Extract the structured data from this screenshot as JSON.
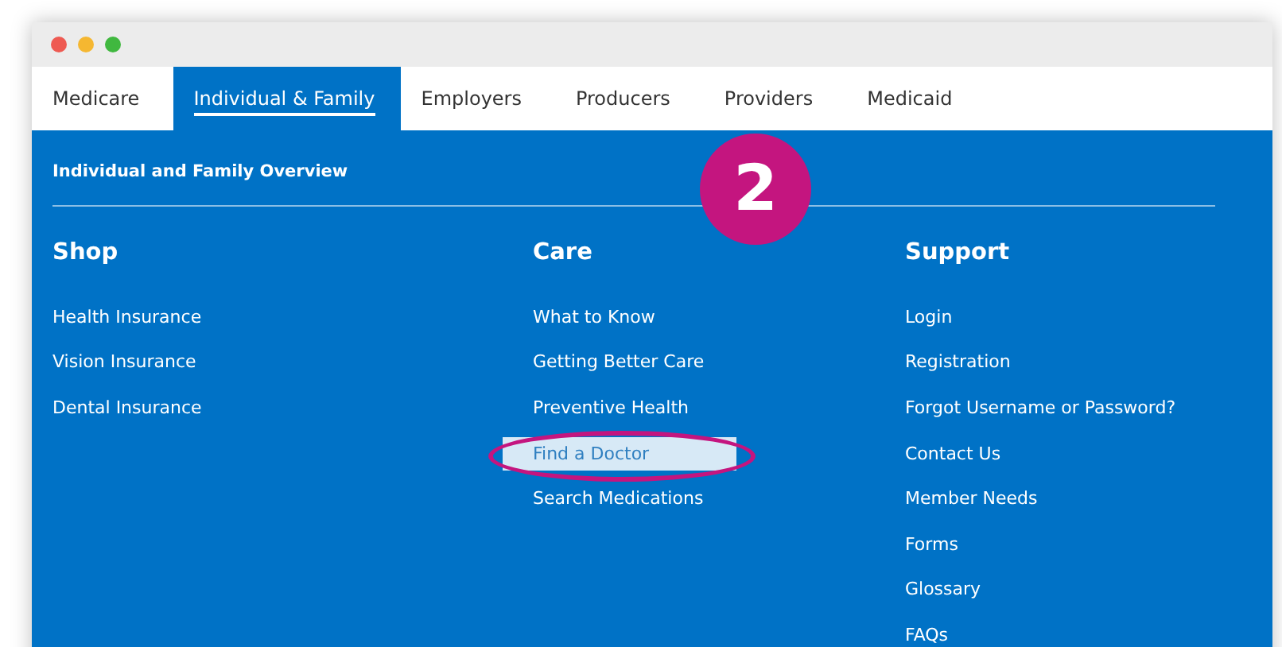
{
  "tabs": [
    {
      "label": "Medicare",
      "selected": false
    },
    {
      "label": "Individual & Family",
      "selected": true
    },
    {
      "label": "Employers",
      "selected": false
    },
    {
      "label": "Producers",
      "selected": false
    },
    {
      "label": "Providers",
      "selected": false
    },
    {
      "label": "Medicaid",
      "selected": false
    }
  ],
  "overview_link": "Individual and Family Overview",
  "step_badge": "2",
  "columns": [
    {
      "heading": "Shop",
      "links": [
        {
          "label": "Health Insurance",
          "highlighted": false
        },
        {
          "label": "Vision Insurance",
          "highlighted": false
        },
        {
          "label": "Dental Insurance",
          "highlighted": false
        }
      ]
    },
    {
      "heading": "Care",
      "links": [
        {
          "label": "What to Know",
          "highlighted": false
        },
        {
          "label": "Getting Better Care",
          "highlighted": false
        },
        {
          "label": "Preventive Health",
          "highlighted": false
        },
        {
          "label": "Find a Doctor",
          "highlighted": true
        },
        {
          "label": "Search Medications",
          "highlighted": false
        }
      ]
    },
    {
      "heading": "Support",
      "links": [
        {
          "label": "Login",
          "highlighted": false
        },
        {
          "label": "Registration",
          "highlighted": false
        },
        {
          "label": "Forgot Username or Password?",
          "highlighted": false
        },
        {
          "label": "Contact Us",
          "highlighted": false
        },
        {
          "label": "Member Needs",
          "highlighted": false
        },
        {
          "label": "Forms",
          "highlighted": false
        },
        {
          "label": "Glossary",
          "highlighted": false
        },
        {
          "label": "FAQs",
          "highlighted": false
        }
      ]
    }
  ]
}
